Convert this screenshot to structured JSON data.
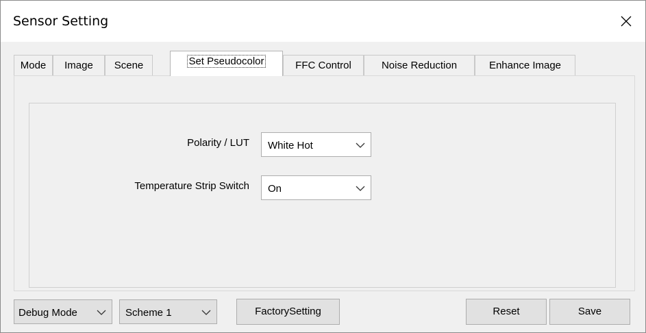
{
  "window": {
    "title": "Sensor Setting"
  },
  "tabs": [
    {
      "label": "Mode"
    },
    {
      "label": "Image"
    },
    {
      "label": "Scene"
    },
    {
      "label": "Set Pseudocolor"
    },
    {
      "label": "FFC Control"
    },
    {
      "label": "Noise Reduction"
    },
    {
      "label": "Enhance Image"
    }
  ],
  "active_tab": "Set Pseudocolor",
  "settings": {
    "polarity_label": "Polarity / LUT",
    "polarity_value": "White Hot",
    "temp_strip_label": "Temperature Strip Switch",
    "temp_strip_value": "On"
  },
  "footer": {
    "debug_mode_value": "Debug Mode",
    "scheme_value": "Scheme 1",
    "factory_label": "FactorySetting",
    "reset_label": "Reset",
    "save_label": "Save"
  },
  "icons": {
    "close": "close-icon",
    "dropdown": "chevron-down-icon"
  }
}
